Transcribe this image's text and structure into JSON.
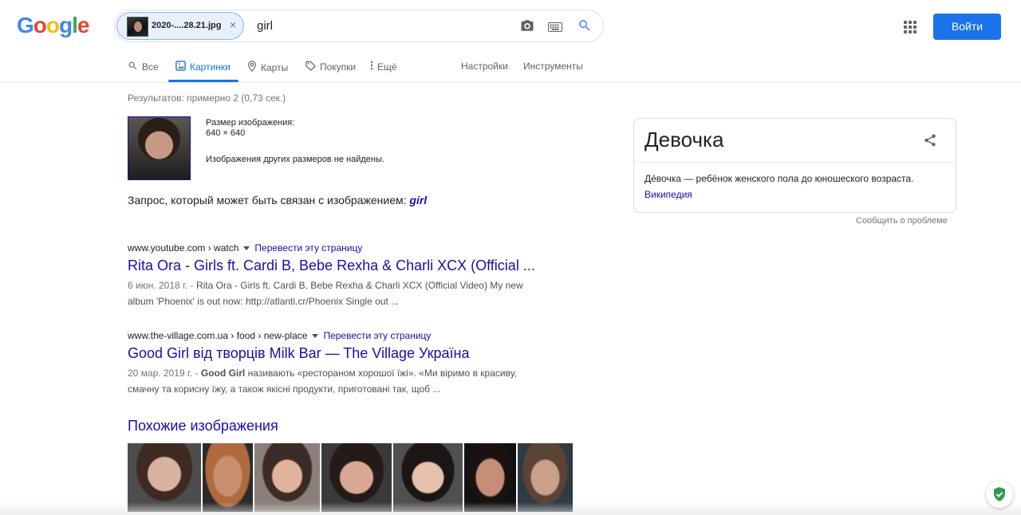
{
  "header": {
    "logo_letters": [
      {
        "ch": "G",
        "color": "#4285F4"
      },
      {
        "ch": "o",
        "color": "#EA4335"
      },
      {
        "ch": "o",
        "color": "#FBBC05"
      },
      {
        "ch": "g",
        "color": "#4285F4"
      },
      {
        "ch": "l",
        "color": "#34A853"
      },
      {
        "ch": "e",
        "color": "#EA4335"
      }
    ],
    "image_chip_name": "2020-....28.21.jpg",
    "image_chip_close": "×",
    "query": "girl",
    "login_label": "Войти"
  },
  "tabs": [
    {
      "label": "Все",
      "icon": "search-icon"
    },
    {
      "label": "Картинки",
      "icon": "image-icon",
      "active": true
    },
    {
      "label": "Карты",
      "icon": "map-pin-icon"
    },
    {
      "label": "Покупки",
      "icon": "tag-icon"
    },
    {
      "label": "Ещё",
      "icon": "more-vert-icon"
    },
    {
      "label": "Настройки"
    },
    {
      "label": "Инструменты"
    }
  ],
  "stats": "Результатов: примерно 2 (0,73 сек.)",
  "image_info": {
    "size_label": "Размер изображения:",
    "size_value": "640 × 640",
    "other_sizes": "Изображения других размеров не найдены."
  },
  "related_query": {
    "prefix": "Запрос, который может быть связан с изображением: ",
    "term": "girl"
  },
  "results": [
    {
      "cite": "www.youtube.com › watch",
      "translate": "Перевести эту страницу",
      "title": "Rita Ora - Girls ft. Cardi B, Bebe Rexha & Charli XCX (Official ...",
      "date": "6 июн. 2018 г. - ",
      "snippet_line1": "Rita Ora - Girls ft. Cardi B, Bebe Rexha & Charli XCX (Official Video) My new",
      "snippet_line2": "album 'Phoenix' is out now: http://atlanti.cr/Phoenix Single out ..."
    },
    {
      "cite": "www.the-village.com.ua › food › new-place",
      "translate": "Перевести эту страницу",
      "title": "Good Girl від творців Milk Bar — The Village Україна",
      "date": "20 мар. 2019 г. - ",
      "snippet_b1": "Good ",
      "snippet_bold": "Girl",
      "snippet_rest1": " називають «рестораном хорошої їжі». «Ми віримо в красиву,",
      "snippet_line2": "смачну та корисну їжу, а також якісні продукти, приготовані так, щоб ..."
    }
  ],
  "similar_heading": "Похожие изображения",
  "knowledge_panel": {
    "title": "Девочка",
    "description": "Де́вочка — ребёнок женского пола до юношеского возраста.",
    "source_link": "Википедия",
    "report": "Сообщить о проблеме"
  },
  "colors": {
    "accent": "#1a73e8",
    "link": "#1a0dab"
  }
}
